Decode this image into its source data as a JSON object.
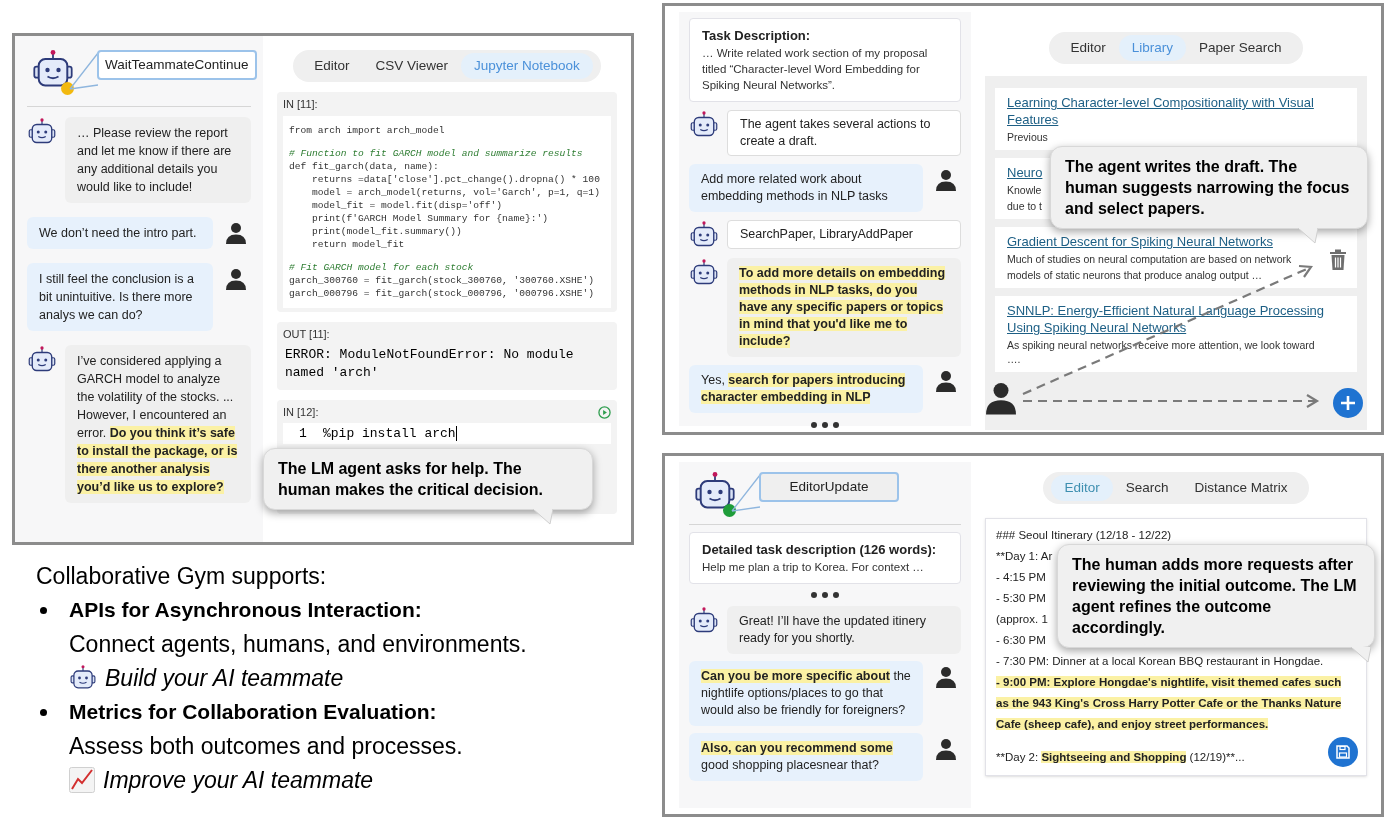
{
  "notebook_panel": {
    "agent_status": {
      "action": "WaitTeammateContinue",
      "color": "#f2b90f"
    },
    "chat": [
      {
        "kind": "agent",
        "segments": [
          {
            "text": "… Please review the report and let me know if there are any additional details you would like to include!",
            "highlight": false
          }
        ]
      },
      {
        "kind": "human",
        "segments": [
          {
            "text": "We don’t need the intro part.",
            "highlight": false
          }
        ]
      },
      {
        "kind": "human",
        "segments": [
          {
            "text": "I still feel the conclusion is a bit unintuitive. Is there more analys we can do?",
            "highlight": false
          }
        ]
      },
      {
        "kind": "agent",
        "segments": [
          {
            "text": "I’ve considered applying a GARCH model to analyze the volatility of the stocks. ... However, I encountered an error. ",
            "highlight": false
          },
          {
            "text": "Do you think it’s safe to install the package, or is there another analysis you’d like us to explore?",
            "highlight": true
          }
        ]
      }
    ],
    "tabs": [
      {
        "label": "Editor",
        "selected": false
      },
      {
        "label": "CSV Viewer",
        "selected": false
      },
      {
        "label": "Jupyter Notebook",
        "selected": true
      }
    ],
    "cells": [
      {
        "kind": "code",
        "label": "IN [11]:",
        "lines": [
          {
            "kind": "code",
            "text": "from arch import arch_model"
          },
          {
            "kind": "blank"
          },
          {
            "kind": "comment",
            "text": "# Function to fit GARCH model and summarize results"
          },
          {
            "kind": "code",
            "text": "def fit_garch(data, name):"
          },
          {
            "kind": "code",
            "text": "    returns =data['close'].pct_change().dropna() * 100"
          },
          {
            "kind": "code",
            "text": "    model = arch_model(returns, vol='Garch', p=1, q=1)"
          },
          {
            "kind": "code",
            "text": "    model_fit = model.fit(disp='off')"
          },
          {
            "kind": "code",
            "text": "    print(f'GARCH Model Summary for {name}:')"
          },
          {
            "kind": "code",
            "text": "    print(model_fit.summary())"
          },
          {
            "kind": "code",
            "text": "    return model_fit"
          },
          {
            "kind": "blank"
          },
          {
            "kind": "comment",
            "text": "# Fit GARCH model for each stock"
          },
          {
            "kind": "code",
            "text": "garch_300760 = fit_garch(stock_300760, '300760.XSHE')"
          },
          {
            "kind": "code",
            "text": "garch_000796 = fit_garch(stock_000796, '000796.XSHE')"
          }
        ]
      },
      {
        "kind": "output",
        "label": "OUT [11]:",
        "text": "ERROR: ModuleNotFoundError: No module named 'arch'"
      },
      {
        "kind": "input",
        "label": "IN [12]:",
        "line_number": "1",
        "text": "%pip install arch"
      }
    ],
    "callout": "The LM agent asks for help. The human makes the critical decision."
  },
  "library_panel": {
    "chat": [
      {
        "kind": "task",
        "title": "Task Description:",
        "body": "… Write related work section of my proposal titled “Character-level Word Embedding for Spiking Neural Networks”."
      },
      {
        "kind": "action",
        "text": "The agent takes several actions to create a draft."
      },
      {
        "kind": "human",
        "segments": [
          {
            "text": "Add more related work about embedding methods in NLP tasks",
            "highlight": false
          }
        ]
      },
      {
        "kind": "action",
        "text": "SearchPaper, LibraryAddPaper"
      },
      {
        "kind": "agent",
        "segments": [
          {
            "text": "To add more details on embedding methods in NLP tasks, do you have any specific papers or topics in mind that you'd like me to include?",
            "highlight": true
          }
        ]
      },
      {
        "kind": "human",
        "segments": [
          {
            "text": "Yes, ",
            "highlight": false
          },
          {
            "text": "search for papers introducing character embedding in NLP",
            "highlight": true
          }
        ]
      },
      {
        "kind": "more"
      }
    ],
    "tabs": [
      {
        "label": "Editor",
        "selected": false
      },
      {
        "label": "Library",
        "selected": true
      },
      {
        "label": "Paper Search",
        "selected": false
      }
    ],
    "papers": [
      {
        "kind": "paper",
        "title": "Learning Character-level Compositionality with Visual Features",
        "description": [
          "Previous"
        ]
      },
      {
        "kind": "paper",
        "title": "Neuro",
        "description": [
          "Knowle",
          "due to t"
        ]
      },
      {
        "kind": "removable",
        "title": "Gradient Descent for Spiking Neural Networks",
        "description": [
          "Much of studies on neural computation are based on network",
          "models of static neurons that produce analog output …"
        ]
      },
      {
        "kind": "paper",
        "title": "SNNLP: Energy-Efficient Natural Language Processing Using Spiking Neural Networks",
        "description": [
          "As spiking neural networks receive more attention, we look toward …."
        ]
      }
    ],
    "callout": "The agent writes the draft. The human suggests narrowing the focus and select papers."
  },
  "itinerary_panel": {
    "agent_status": {
      "action": "EditorUpdate",
      "color": "#1f9d3a"
    },
    "chat": [
      {
        "kind": "task",
        "title": "Detailed task description (126 words):",
        "body": "Help me plan a trip to Korea. For context …"
      },
      {
        "kind": "more"
      },
      {
        "kind": "agent",
        "segments": [
          {
            "text": "Great! I’ll have the updated itinery ready for you shortly.",
            "highlight": false
          }
        ]
      },
      {
        "kind": "human",
        "segments": [
          {
            "text": "Can you be more specific about",
            "highlight": true
          },
          {
            "text": " the nightlife options/places to go that would also be friendly for foreigners?",
            "highlight": false
          }
        ]
      },
      {
        "kind": "human",
        "segments": [
          {
            "text": "Also, can you recommend some",
            "highlight": true
          },
          {
            "text": " good shopping placesnear that?",
            "highlight": false
          }
        ]
      }
    ],
    "tabs": [
      {
        "label": "Editor",
        "selected": true
      },
      {
        "label": "Search",
        "selected": false
      },
      {
        "label": "Distance Matrix",
        "selected": false
      }
    ],
    "document": [
      {
        "kind": "text",
        "segments": [
          {
            "text": "### Seoul Itinerary (12/18 - 12/22)",
            "highlight": false
          }
        ]
      },
      {
        "kind": "text",
        "segments": [
          {
            "text": "**Day 1: Ar",
            "highlight": false
          }
        ]
      },
      {
        "kind": "text",
        "segments": [
          {
            "text": "- 4:15 PM",
            "highlight": false
          }
        ]
      },
      {
        "kind": "text",
        "segments": [
          {
            "text": "- 5:30 PM",
            "highlight": false
          }
        ]
      },
      {
        "kind": "text",
        "segments": [
          {
            "text": "(approx. 1",
            "highlight": false
          }
        ]
      },
      {
        "kind": "text",
        "segments": [
          {
            "text": "- 6:30 PM",
            "highlight": false
          }
        ]
      },
      {
        "kind": "text",
        "segments": [
          {
            "text": "- 7:30 PM: Dinner at a local Korean BBQ restaurant in Hongdae.",
            "highlight": false
          }
        ]
      },
      {
        "kind": "text",
        "segments": [
          {
            "text": "- 9:00 PM: Explore Hongdae's nightlife, visit themed cafes such as the 943 King's Cross Harry Potter Cafe or the Thanks Nature Cafe (sheep cafe), and enjoy street performances.",
            "highlight": true
          }
        ]
      },
      {
        "kind": "blank"
      },
      {
        "kind": "text",
        "segments": [
          {
            "text": "**Day 2: ",
            "highlight": false
          },
          {
            "text": "Sightseeing and Shopping",
            "highlight": true
          },
          {
            "text": " (12/19)**...",
            "highlight": false
          }
        ]
      }
    ],
    "callout": "The human adds more requests after reviewing the initial outcome. The LM agent refines the outcome accordingly."
  },
  "summary": {
    "title": "Collaborative Gym supports:",
    "items": [
      {
        "kind": "robot",
        "heading": "APIs for Asynchronous Interaction:",
        "description": "Connect agents, humans, and environments.",
        "goal": "Build your AI teammate"
      },
      {
        "kind": "chart",
        "heading": "Metrics for Collaboration Evaluation:",
        "description": "Assess both outcomes and processes.",
        "goal": "Improve your AI teammate"
      }
    ]
  }
}
